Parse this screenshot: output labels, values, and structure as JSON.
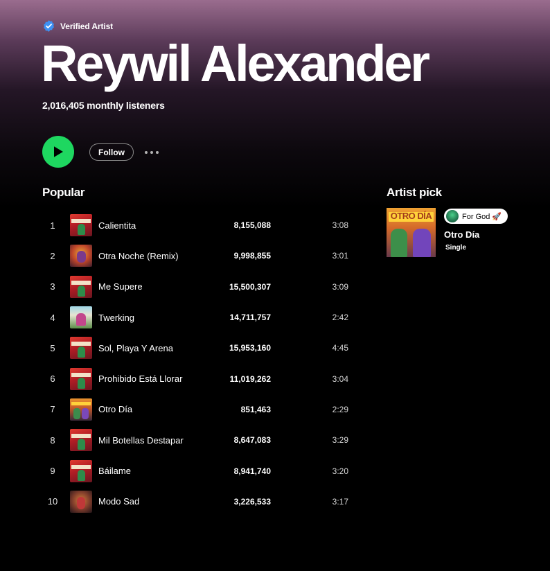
{
  "header": {
    "verified_label": "Verified Artist",
    "artist_name": "Reywil Alexander",
    "monthly_listeners": "2,016,405 monthly listeners"
  },
  "actions": {
    "play_icon": "play-icon",
    "follow_label": "Follow",
    "more_icon": "more-options-icon"
  },
  "colors": {
    "accent": "#1ed760",
    "verified": "#3d91f4"
  },
  "popular": {
    "title": "Popular",
    "tracks": [
      {
        "num": "1",
        "title": "Calientita",
        "plays": "8,155,088",
        "duration": "3:08",
        "cover": "fantasias"
      },
      {
        "num": "2",
        "title": "Otra Noche (Remix)",
        "plays": "9,998,855",
        "duration": "3:01",
        "cover": "noche"
      },
      {
        "num": "3",
        "title": "Me Supere",
        "plays": "15,500,307",
        "duration": "3:09",
        "cover": "fantasias"
      },
      {
        "num": "4",
        "title": "Twerking",
        "plays": "14,711,757",
        "duration": "2:42",
        "cover": "twerking"
      },
      {
        "num": "5",
        "title": "Sol, Playa Y Arena",
        "plays": "15,953,160",
        "duration": "4:45",
        "cover": "fantasias"
      },
      {
        "num": "6",
        "title": "Prohibido Está Llorar",
        "plays": "11,019,262",
        "duration": "3:04",
        "cover": "fantasias"
      },
      {
        "num": "7",
        "title": "Otro Día",
        "plays": "851,463",
        "duration": "2:29",
        "cover": "otro-dia"
      },
      {
        "num": "8",
        "title": "Mil Botellas Destapar",
        "plays": "8,647,083",
        "duration": "3:29",
        "cover": "fantasias"
      },
      {
        "num": "9",
        "title": "Báilame",
        "plays": "8,941,740",
        "duration": "3:20",
        "cover": "fantasias"
      },
      {
        "num": "10",
        "title": "Modo Sad",
        "plays": "3,226,533",
        "duration": "3:17",
        "cover": "modo-sad"
      }
    ]
  },
  "artist_pick": {
    "title": "Artist pick",
    "pill_text": "For God 🚀",
    "release_name": "Otro Día",
    "release_type": "Single",
    "cover_text": "OTRO DÍA"
  }
}
